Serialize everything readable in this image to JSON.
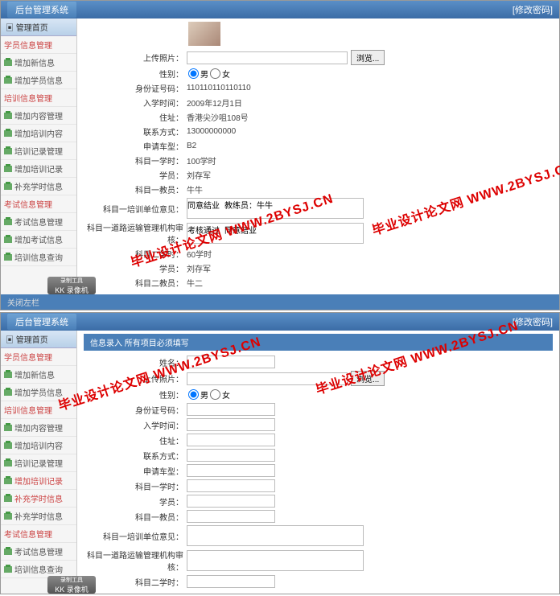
{
  "app_title": "后台管理系统",
  "hdr_right": "[修改密码]",
  "footer": "关闭左栏",
  "sidebar": {
    "header": "管理首页",
    "groups": [
      {
        "title": "学员信息管理",
        "items": [
          {
            "label": "增加新信息"
          },
          {
            "label": "增加学员信息"
          }
        ]
      },
      {
        "title": "培训信息管理",
        "items": [
          {
            "label": "增加内容管理"
          },
          {
            "label": "增加培训内容"
          },
          {
            "label": "培训记录管理"
          },
          {
            "label": "增加培训记录"
          },
          {
            "label": "补充学时信息"
          }
        ]
      },
      {
        "title": "考试信息管理",
        "items": [
          {
            "label": "考试信息管理"
          },
          {
            "label": "增加考试信息"
          },
          {
            "label": "培训信息查询"
          }
        ]
      }
    ]
  },
  "watermark": {
    "t": "录制工具",
    "b": "KK 录像机"
  },
  "diag": "毕业设计论文网 WWW.2BYSJ.CN",
  "p1": {
    "upload_photo": "上传照片：",
    "browse": "浏览...",
    "gender": "性别：",
    "male": "男",
    "female": "女",
    "id_no": "身份证号码：",
    "id_val": "110110110110110",
    "enroll": "入学时间：",
    "enroll_val": "2009年12月1日",
    "addr": "住址：",
    "addr_val": "香港尖沙咀108号",
    "contact": "联系方式：",
    "contact_val": "13000000000",
    "car": "申请车型：",
    "car_val": "B2",
    "s1h": "科目一学时：",
    "s1h_val": "100学时",
    "stu": "学员：",
    "stu_val": "刘存军",
    "s1t": "科目一教员：",
    "s1t_val": "牛牛",
    "s1op": "科目一培训单位意见：",
    "s1op_val": "同意结业 教练员：牛牛",
    "s1au": "科目一道路运输管理机构审核：",
    "s1au_val": "考核通过 同意结业",
    "s2h": "科目二学时：",
    "s2h_val": "60学时",
    "stu2": "学员：",
    "stu2_val": "刘存军",
    "s2t": "科目二教员：",
    "s2t_val": "牛二"
  },
  "p2": {
    "bar": "信息录入 所有项目必须填写",
    "name": "姓名：",
    "upload_photo": "上传照片：",
    "browse": "浏览...",
    "gender": "性别：",
    "male": "男",
    "female": "女",
    "id_no": "身份证号码：",
    "enroll": "入学时间：",
    "addr": "住址：",
    "contact": "联系方式：",
    "car": "申请车型：",
    "s1h": "科目一学时：",
    "stu": "学员：",
    "s1t": "科目一教员：",
    "s1op": "科目一培训单位意见：",
    "s1au": "科目一道路运输管理机构审核：",
    "s2h": "科目二学时："
  }
}
